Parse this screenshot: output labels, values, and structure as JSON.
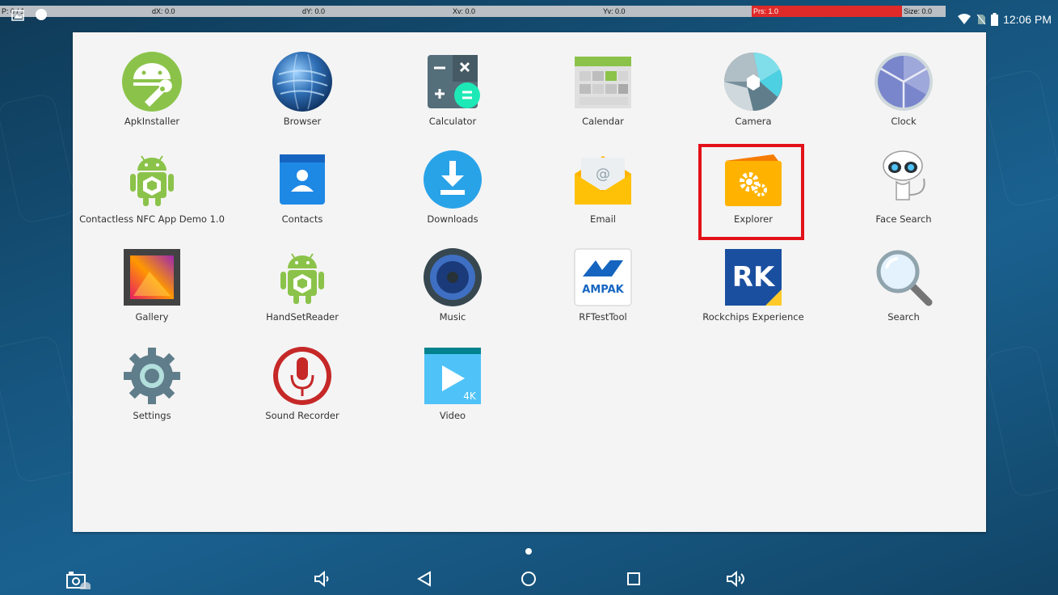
{
  "pointer_bar": {
    "p": "P: 0 / 1",
    "dx": "dX: 0.0",
    "dy": "dY: 0.0",
    "xv": "Xv: 0.0",
    "yv": "Yv: 0.0",
    "prs": "Prs: 1.0",
    "size": "Size: 0.0"
  },
  "status": {
    "time": "12:06 PM",
    "icons": [
      "wifi-icon",
      "no-sim-icon",
      "battery-icon"
    ]
  },
  "apps": [
    {
      "label": "ApkInstaller",
      "icon": "apkinstaller-icon"
    },
    {
      "label": "Browser",
      "icon": "browser-icon"
    },
    {
      "label": "Calculator",
      "icon": "calculator-icon"
    },
    {
      "label": "Calendar",
      "icon": "calendar-icon"
    },
    {
      "label": "Camera",
      "icon": "camera-icon"
    },
    {
      "label": "Clock",
      "icon": "clock-icon"
    },
    {
      "label": "Contactless NFC App Demo 1.0",
      "icon": "android-app-icon"
    },
    {
      "label": "Contacts",
      "icon": "contacts-icon"
    },
    {
      "label": "Downloads",
      "icon": "downloads-icon"
    },
    {
      "label": "Email",
      "icon": "email-icon"
    },
    {
      "label": "Explorer",
      "icon": "explorer-icon",
      "highlighted": true
    },
    {
      "label": "Face Search",
      "icon": "face-search-icon"
    },
    {
      "label": "Gallery",
      "icon": "gallery-icon"
    },
    {
      "label": "HandSetReader",
      "icon": "android-app-icon"
    },
    {
      "label": "Music",
      "icon": "music-icon"
    },
    {
      "label": "RFTestTool",
      "icon": "ampak-icon"
    },
    {
      "label": "Rockchips Experience",
      "icon": "rk-icon"
    },
    {
      "label": "Search",
      "icon": "search-icon"
    },
    {
      "label": "Settings",
      "icon": "settings-icon"
    },
    {
      "label": "Sound Recorder",
      "icon": "sound-recorder-icon"
    },
    {
      "label": "Video",
      "icon": "video-icon"
    }
  ],
  "icon_text": {
    "ampak": "AMPAK",
    "rk": "RK",
    "video_4k": "4K"
  },
  "nav": [
    "screenshot-icon",
    "volume-down-icon",
    "back-icon",
    "home-icon",
    "recents-icon",
    "volume-up-icon"
  ],
  "colors": {
    "highlight": "#e3111a",
    "prs_bar": "#e02a2a"
  }
}
